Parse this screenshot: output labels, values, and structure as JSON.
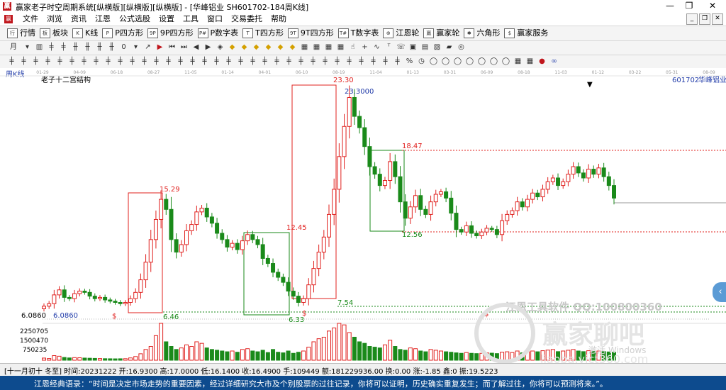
{
  "window": {
    "title": "赢家老子时空周期系统[纵横版][纵横版][纵横版] - [华峰铝业  SH601702-184周K线]",
    "controls": [
      "—",
      "❐",
      "✕"
    ]
  },
  "menu": {
    "items": [
      "文件",
      "浏览",
      "资讯",
      "江恩",
      "公式选股",
      "设置",
      "工具",
      "窗口",
      "交易委托",
      "帮助"
    ],
    "mdi_controls": [
      "_",
      "❐",
      "✕"
    ]
  },
  "toolbar1": {
    "items": [
      {
        "icon": "行",
        "label": "行情"
      },
      {
        "icon": "板",
        "label": "板块"
      },
      {
        "icon": "K",
        "label": "K线"
      },
      {
        "icon": "P",
        "label": "P四方形"
      },
      {
        "icon": "9P",
        "label": "9P四方形"
      },
      {
        "icon": "P#",
        "label": "P数字表"
      },
      {
        "icon": "T",
        "label": "T四方形"
      },
      {
        "icon": "9T",
        "label": "9T四方形"
      },
      {
        "icon": "T#",
        "label": "T数字表"
      },
      {
        "icon": "⊕",
        "label": "江恩轮"
      },
      {
        "icon": "赢",
        "label": "赢家轮"
      },
      {
        "icon": "✱",
        "label": "六角形"
      },
      {
        "icon": "$",
        "label": "赢家服务"
      }
    ]
  },
  "toolbar2": {
    "period_label": "月",
    "zero_label": "0"
  },
  "chart": {
    "period_label": "周K线",
    "structure_label": "老子十二宫结构",
    "stock_code": "601702",
    "stock_name": "华峰铝业",
    "date_ticks": [
      "01-29",
      "04-09",
      "06-18",
      "08-27",
      "11-05",
      "01-14",
      "04-01",
      "06-10",
      "08-19",
      "11-04",
      "01-13",
      "03-31",
      "06-09",
      "08-18",
      "11-03",
      "01-12",
      "03-22",
      "05-31",
      "08-09"
    ],
    "price_labels": {
      "low_left": "6.0860",
      "low_left2": "6.0860",
      "top_high": "23.30",
      "top_high_precise": "23.3000",
      "box2_high": "15.29",
      "box2_low": "6.46",
      "mid_low": "6.33",
      "mid_mark": "12.45",
      "bottom_mark": "7.54",
      "right_high": "18.47",
      "right_low": "12.56"
    },
    "volume_ticks": [
      "2250705",
      "1500470",
      "750235"
    ],
    "dollar_marks": [
      "$",
      "$",
      "$"
    ],
    "watermark_tool": "江恩工具软件  QQ:100800360",
    "watermark_brand": "赢家聊吧",
    "watermark_activate": "激活 Windows",
    "watermark_url": "liaoba.vict360.com"
  },
  "chart_data": {
    "type": "candlestick",
    "title": "",
    "x_ticks": [
      "01-29",
      "04-09",
      "06-18",
      "08-27",
      "11-05",
      "01-14",
      "04-01",
      "06-10",
      "08-19",
      "11-04",
      "01-13",
      "03-31",
      "06-09",
      "08-18",
      "11-03",
      "01-12",
      "03-22",
      "05-31",
      "08-09"
    ],
    "series": [
      {
        "name": "",
        "close": [
          6.3,
          6.5,
          7.2,
          7.6,
          7.0,
          6.9,
          7.3,
          7.5,
          7.4,
          7.1,
          6.9,
          7.0,
          6.8,
          6.7,
          6.6,
          6.5,
          6.6,
          6.9,
          7.4,
          8.4,
          9.8,
          11.6,
          13.2,
          14.8,
          14.0,
          11.6,
          10.6,
          11.2,
          12.3,
          12.8,
          13.8,
          14.1,
          13.4,
          12.9,
          12.1,
          11.6,
          11.0,
          11.3,
          10.8,
          11.5,
          12.0,
          11.6,
          11.2,
          10.1,
          9.7,
          9.0,
          8.6,
          8.2,
          7.5,
          7.1,
          6.6,
          6.9,
          8.0,
          9.3,
          10.6,
          11.8,
          13.6,
          15.6,
          18.2,
          20.6,
          22.9,
          21.4,
          20.5,
          19.0,
          17.4,
          16.8,
          15.9,
          16.3,
          17.8,
          16.6,
          14.6,
          13.3,
          14.2,
          15.1,
          14.0,
          13.6,
          14.6,
          15.2,
          15.4,
          14.9,
          13.7,
          12.4,
          12.2,
          12.7,
          12.1,
          11.9,
          12.2,
          12.5,
          12.4,
          12.0,
          13.1,
          13.6,
          13.9,
          14.6,
          14.2,
          14.8,
          15.3,
          15.0,
          15.6,
          16.2,
          16.5,
          15.9,
          16.2,
          16.8,
          17.4,
          16.9,
          16.5,
          17.2,
          16.8,
          17.3,
          16.6,
          15.9,
          14.9
        ],
        "volume": [
          140,
          110,
          300,
          260,
          180,
          150,
          170,
          160,
          140,
          130,
          120,
          110,
          100,
          95,
          90,
          95,
          100,
          150,
          240,
          420,
          700,
          900,
          1600,
          2400,
          1200,
          900,
          700,
          800,
          1000,
          900,
          1200,
          1100,
          800,
          700,
          650,
          600,
          550,
          600,
          520,
          700,
          750,
          600,
          550,
          650,
          500,
          700,
          520,
          480,
          600,
          450,
          520,
          600,
          850,
          1200,
          1400,
          1500,
          1900,
          2100,
          2400,
          2300,
          1800,
          1500,
          1200,
          1100,
          900,
          850,
          800,
          1000,
          1300,
          900,
          700,
          650,
          800,
          750,
          600,
          550,
          700,
          650,
          600,
          550,
          520,
          480,
          450,
          500,
          450,
          430,
          450,
          480,
          460,
          430,
          520,
          550,
          500,
          600,
          480,
          560,
          600,
          550,
          620,
          660,
          700,
          560,
          600,
          650,
          700,
          600,
          560,
          620,
          580,
          600,
          560,
          540,
          520
        ]
      }
    ],
    "ylim": [
      5.5,
      24
    ],
    "volume_ticks": [
      2250705,
      1500470,
      750235
    ],
    "annotations": [
      "23.30",
      "23.3000",
      "15.29",
      "6.46",
      "6.33",
      "12.45",
      "7.54",
      "18.47",
      "12.56",
      "6.0860"
    ]
  },
  "status": {
    "text": "[十一月初十 冬至] 时间:20231222 开:16.9300 高:17.0000 低:16.1400 收:16.4900 手:109449 额:181229936.00 换:0.00 涨:-1.85 鑫:0 振:19.5223"
  },
  "quote": {
    "text": "江恩经典语录：“时间是决定市场走势的重要因素，经过详细研究大市及个别股票的过往记录，你将可以证明，历史确实重复发生；而了解过往，你将可以预测将来。”。"
  },
  "colors": {
    "up": "#e0201e",
    "down": "#1a8a1a",
    "accent_blue": "#1f3aa8",
    "quote_bg": "#0d4b8e"
  }
}
